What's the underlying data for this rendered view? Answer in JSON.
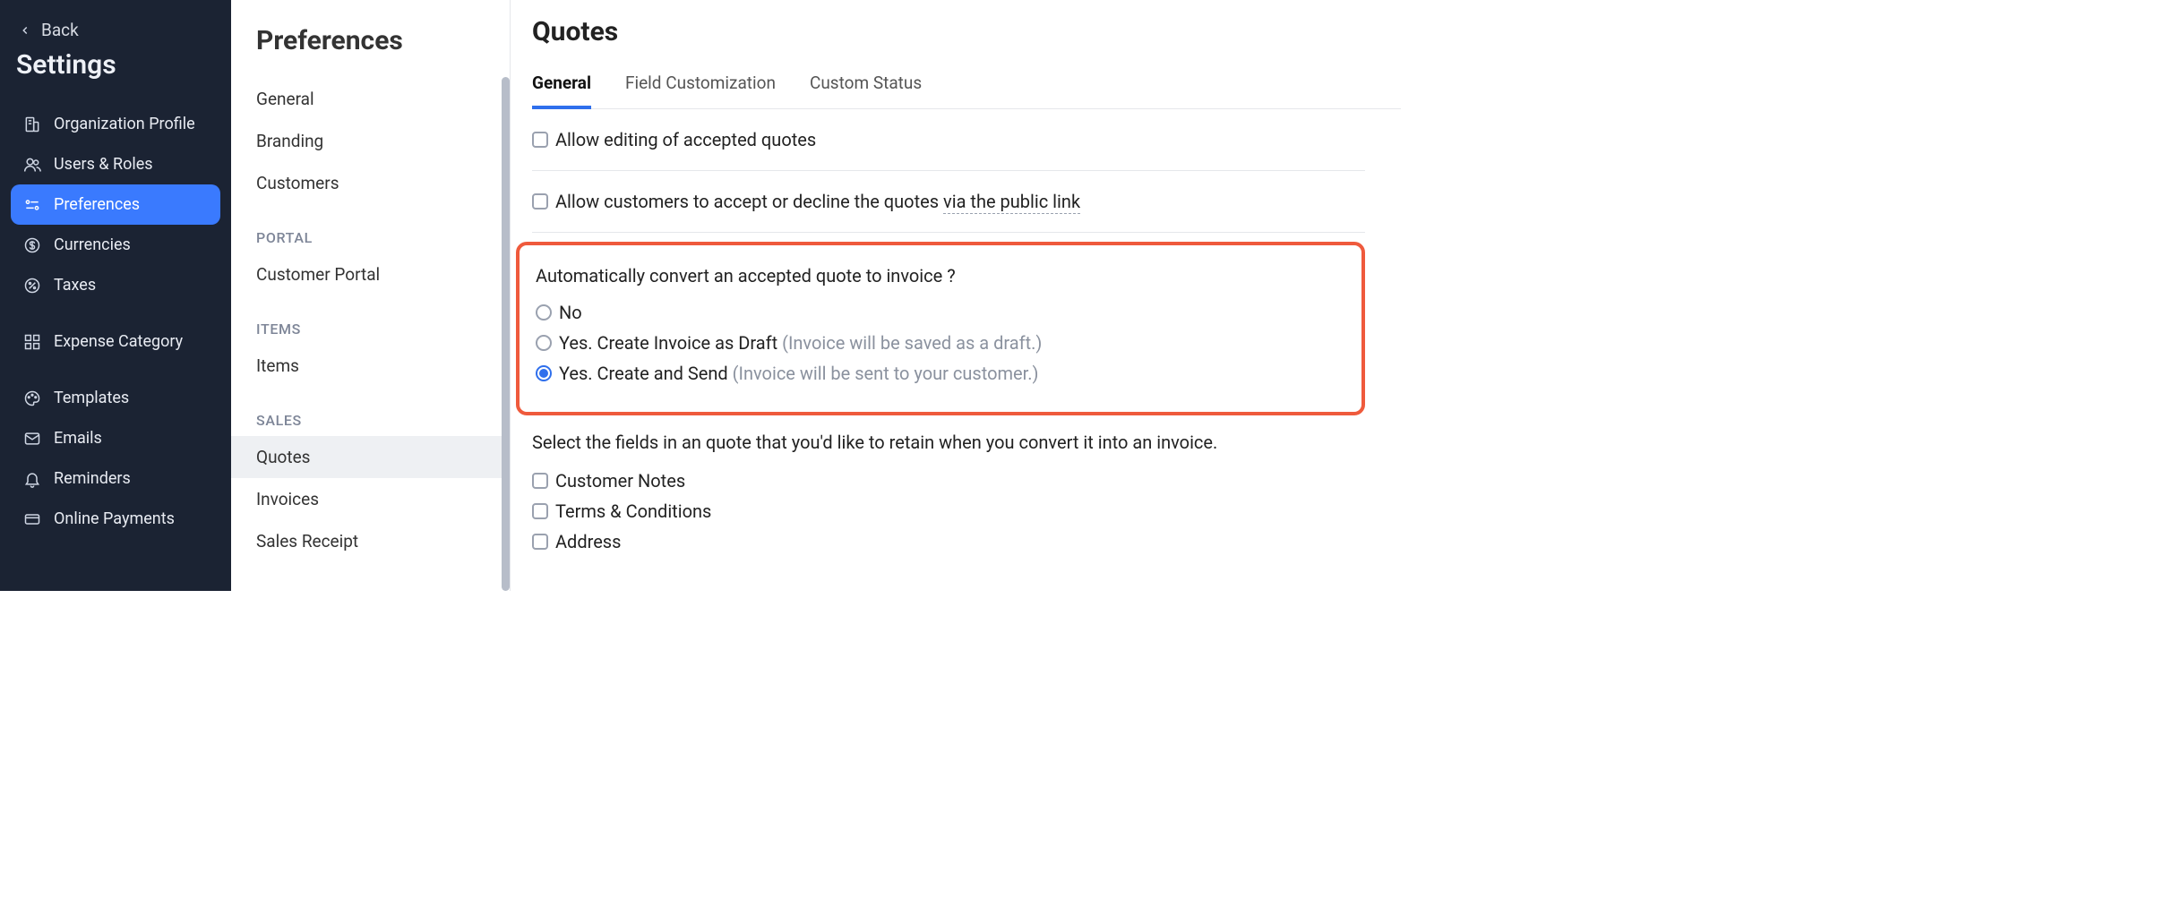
{
  "darkSidebar": {
    "back": "Back",
    "title": "Settings",
    "items": [
      {
        "id": "org-profile",
        "label": "Organization Profile",
        "icon": "building"
      },
      {
        "id": "users-roles",
        "label": "Users & Roles",
        "icon": "users"
      },
      {
        "id": "preferences",
        "label": "Preferences",
        "icon": "sliders",
        "active": true
      },
      {
        "id": "currencies",
        "label": "Currencies",
        "icon": "dollar"
      },
      {
        "id": "taxes",
        "label": "Taxes",
        "icon": "percent"
      },
      {
        "id": "expense-category",
        "label": "Expense Category",
        "icon": "grid"
      },
      {
        "id": "templates",
        "label": "Templates",
        "icon": "palette"
      },
      {
        "id": "emails",
        "label": "Emails",
        "icon": "mail"
      },
      {
        "id": "reminders",
        "label": "Reminders",
        "icon": "bell"
      },
      {
        "id": "online-payments",
        "label": "Online Payments",
        "icon": "card"
      }
    ]
  },
  "lightSidebar": {
    "title": "Preferences",
    "groups": [
      {
        "heading": null,
        "items": [
          {
            "id": "general",
            "label": "General"
          },
          {
            "id": "branding",
            "label": "Branding"
          },
          {
            "id": "customers",
            "label": "Customers"
          }
        ]
      },
      {
        "heading": "PORTAL",
        "items": [
          {
            "id": "customer-portal",
            "label": "Customer Portal"
          }
        ]
      },
      {
        "heading": "ITEMS",
        "items": [
          {
            "id": "items",
            "label": "Items"
          }
        ]
      },
      {
        "heading": "SALES",
        "items": [
          {
            "id": "quotes",
            "label": "Quotes",
            "active": true
          },
          {
            "id": "invoices",
            "label": "Invoices"
          },
          {
            "id": "sales-receipt",
            "label": "Sales Receipt"
          }
        ]
      }
    ]
  },
  "main": {
    "title": "Quotes",
    "tabs": [
      {
        "id": "general",
        "label": "General",
        "active": true
      },
      {
        "id": "field-customization",
        "label": "Field Customization"
      },
      {
        "id": "custom-status",
        "label": "Custom Status"
      }
    ],
    "option_allow_editing": "Allow editing of accepted quotes",
    "option_accept_decline_prefix": "Allow customers to accept or decline the quotes ",
    "option_accept_decline_link": "via the public link",
    "auto_convert": {
      "question": "Automatically convert an accepted quote to invoice ?",
      "opt_no": "No",
      "opt_draft_label": "Yes. Create Invoice as Draft ",
      "opt_draft_hint": "(Invoice will be saved as a draft.)",
      "opt_send_label": "Yes. Create and Send ",
      "opt_send_hint": "(Invoice will be sent to your customer.)",
      "selected": "send"
    },
    "retain": {
      "title": "Select the fields in an quote that you'd like to retain when you convert it into an invoice.",
      "fields": [
        {
          "id": "customer-notes",
          "label": "Customer Notes"
        },
        {
          "id": "terms",
          "label": "Terms & Conditions"
        },
        {
          "id": "address",
          "label": "Address"
        }
      ]
    }
  }
}
